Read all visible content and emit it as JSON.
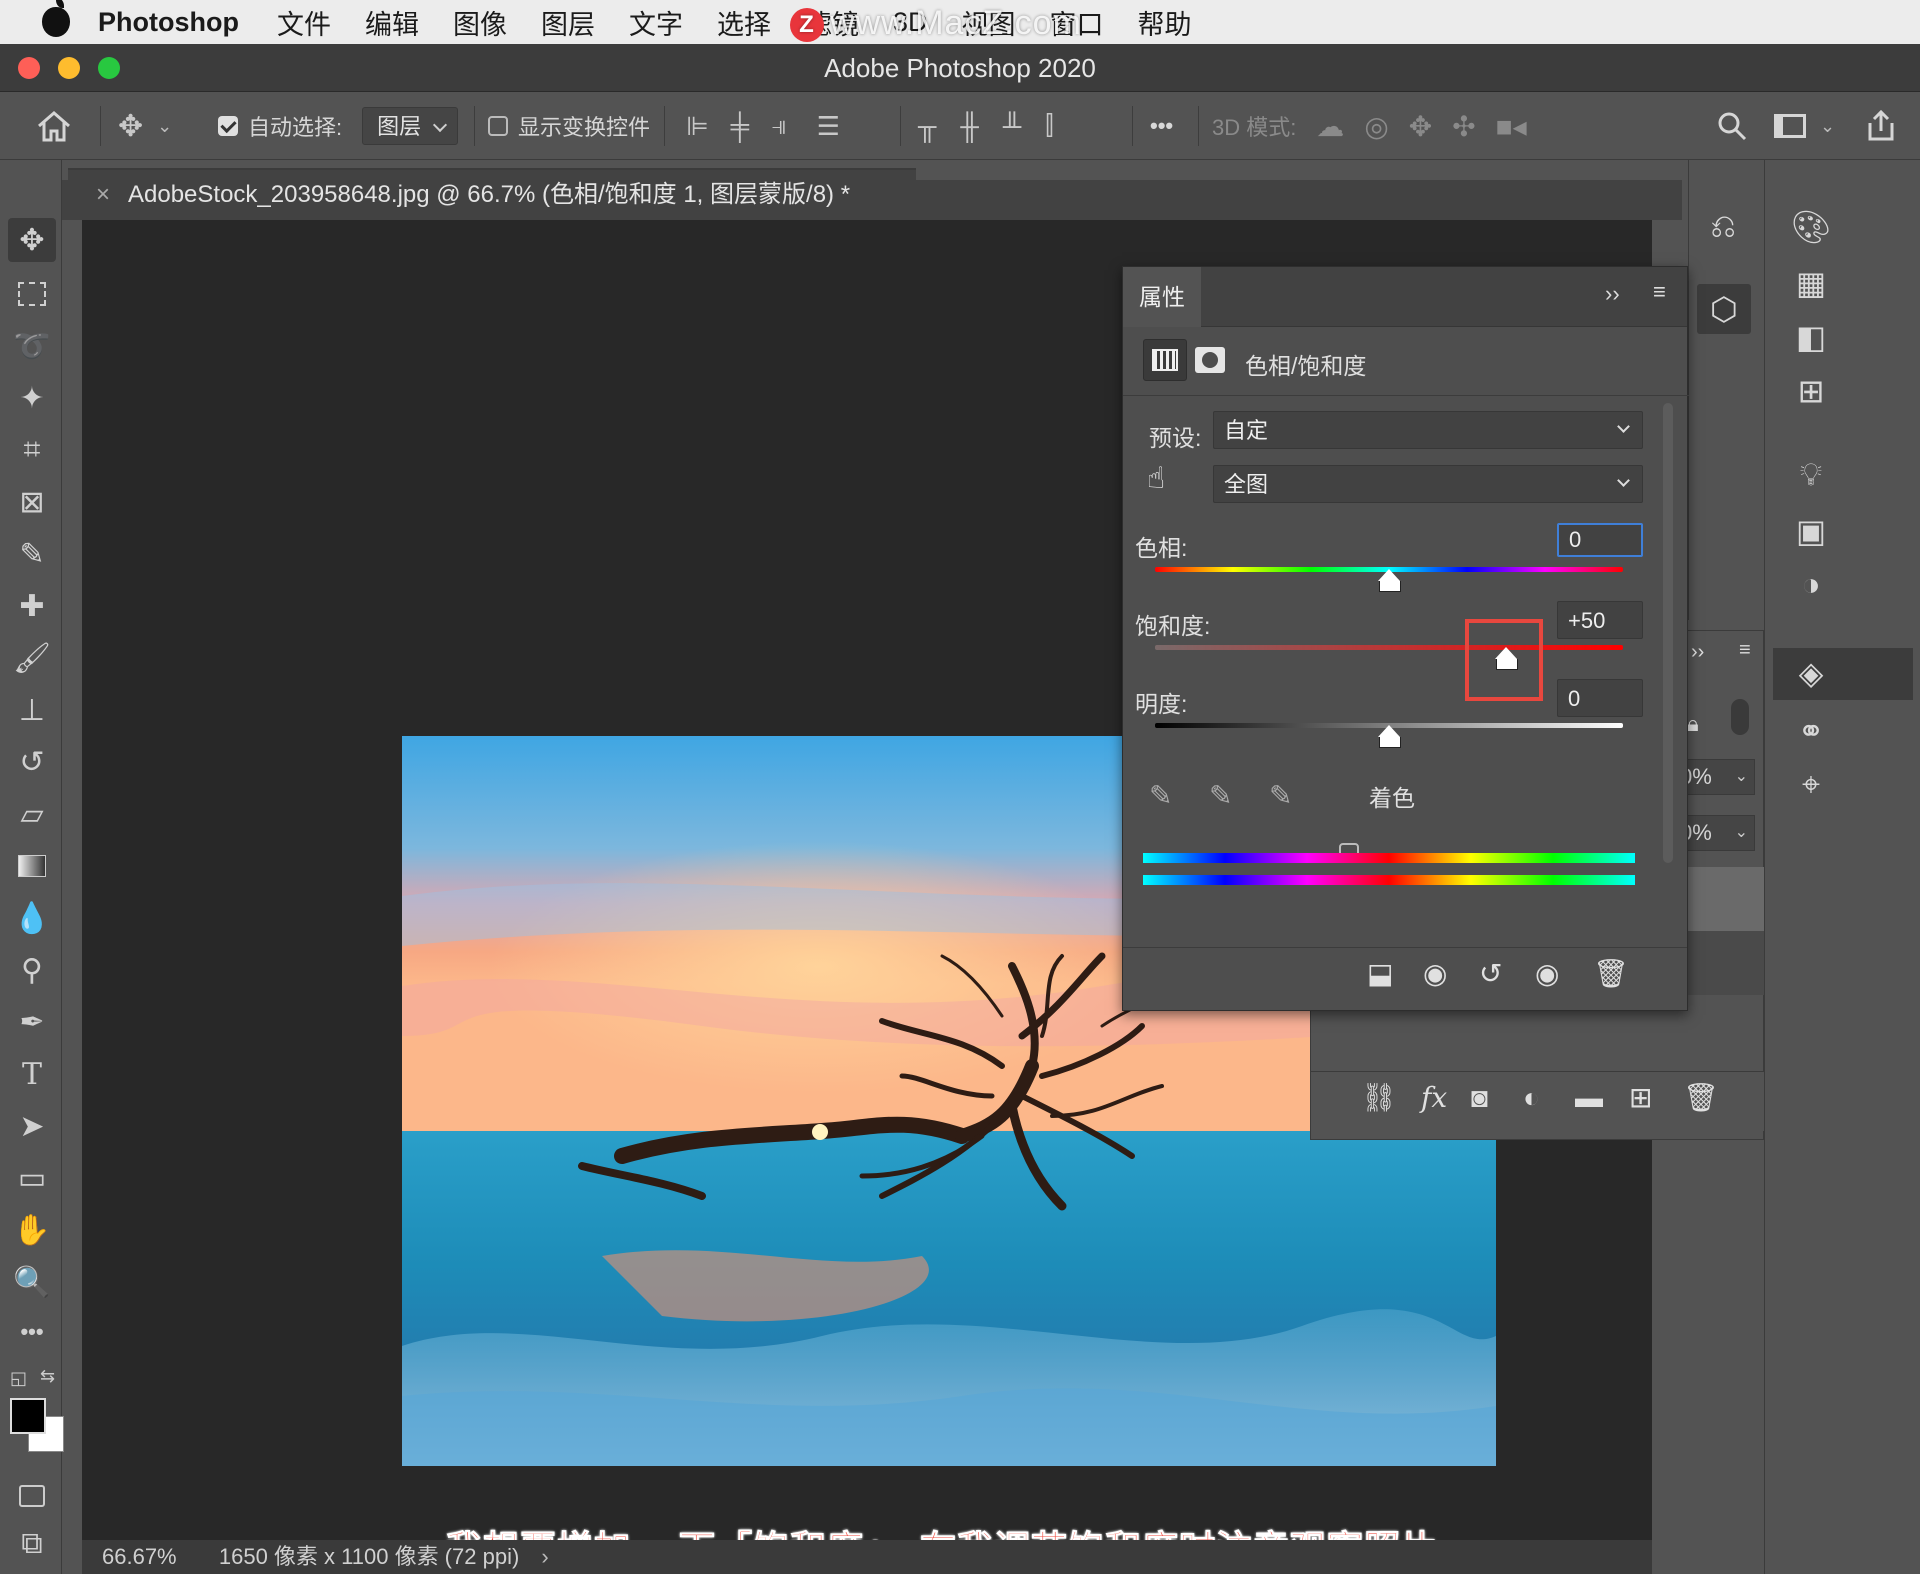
{
  "menubar": {
    "app": "Photoshop",
    "items": [
      "文件",
      "编辑",
      "图像",
      "图层",
      "文字",
      "选择",
      "滤镜",
      "3D",
      "视图",
      "窗口",
      "帮助"
    ],
    "watermark": "www.MacZ.com"
  },
  "window": {
    "title": "Adobe Photoshop 2020"
  },
  "options_bar": {
    "auto_select_label": "自动选择:",
    "auto_select_checked": true,
    "auto_select_target": "图层",
    "show_transform_label": "显示变换控件",
    "show_transform_checked": false,
    "mode_3d_label": "3D 模式:",
    "more_label": "•••"
  },
  "document": {
    "tab_title": "AdobeStock_203958648.jpg @ 66.7% (色相/饱和度 1, 图层蒙版/8) *",
    "zoom": "66.67%",
    "info": "1650 像素 x 1100 像素 (72 ppi)",
    "caption": "我想要增加 一下「饱和度」，在我调节饱和度时注意观察照片"
  },
  "properties": {
    "tab_label": "属性",
    "adjustment_name": "色相/饱和度",
    "preset_label": "预设:",
    "preset_value": "自定",
    "channel_value": "全图",
    "hue_label": "色相:",
    "hue_value": "0",
    "saturation_label": "饱和度:",
    "saturation_value": "+50",
    "lightness_label": "明度:",
    "lightness_value": "0",
    "colorize_label": "着色",
    "colorize_checked": false,
    "hue_slider_fraction": 0.5,
    "saturation_slider_fraction": 0.75,
    "lightness_slider_fraction": 0.5
  },
  "layers_panel": {
    "opacity_partial": "0%",
    "fill_partial": "0%"
  },
  "colors": {
    "highlight_box": "#e8473e",
    "caption_text": "#ef4a3d",
    "canvas_bg": "#282828",
    "panel_bg": "#535353"
  }
}
